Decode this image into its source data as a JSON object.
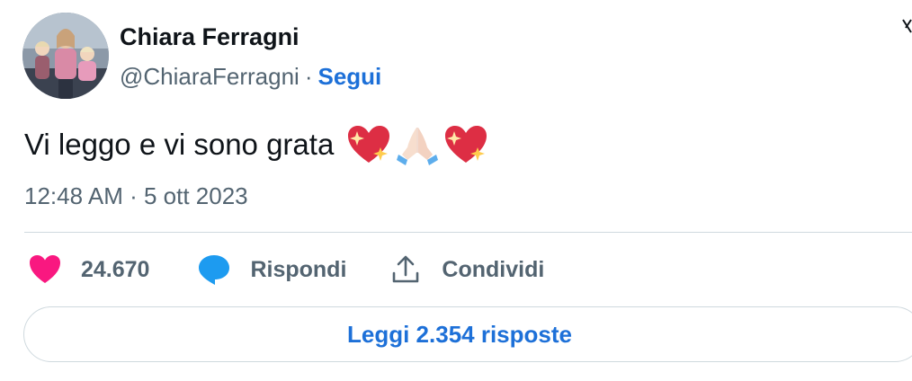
{
  "tweet": {
    "author": {
      "display_name": "Chiara Ferragni",
      "handle": "@ChiaraFerragni",
      "separator": "·",
      "follow_label": "Segui",
      "avatar_icon": "profile-photo"
    },
    "text": "Vi leggo e vi sono grata",
    "emojis": [
      "sparkling-heart-icon",
      "folded-hands-icon",
      "sparkling-heart-icon"
    ],
    "timestamp": "12:48 AM · 5 ott 2023",
    "actions": {
      "like": {
        "icon": "heart-icon",
        "count": "24.670"
      },
      "reply": {
        "icon": "speech-bubble-icon",
        "label": "Rispondi"
      },
      "share": {
        "icon": "share-upload-icon",
        "label": "Condividi"
      }
    },
    "read_replies_label": "Leggi 2.354 risposte"
  },
  "colors": {
    "link_blue": "#1d70d8",
    "like_pink": "#f91880",
    "reply_blue": "#1d9bf0",
    "muted_gray": "#536471",
    "divider": "#cfd9de"
  }
}
